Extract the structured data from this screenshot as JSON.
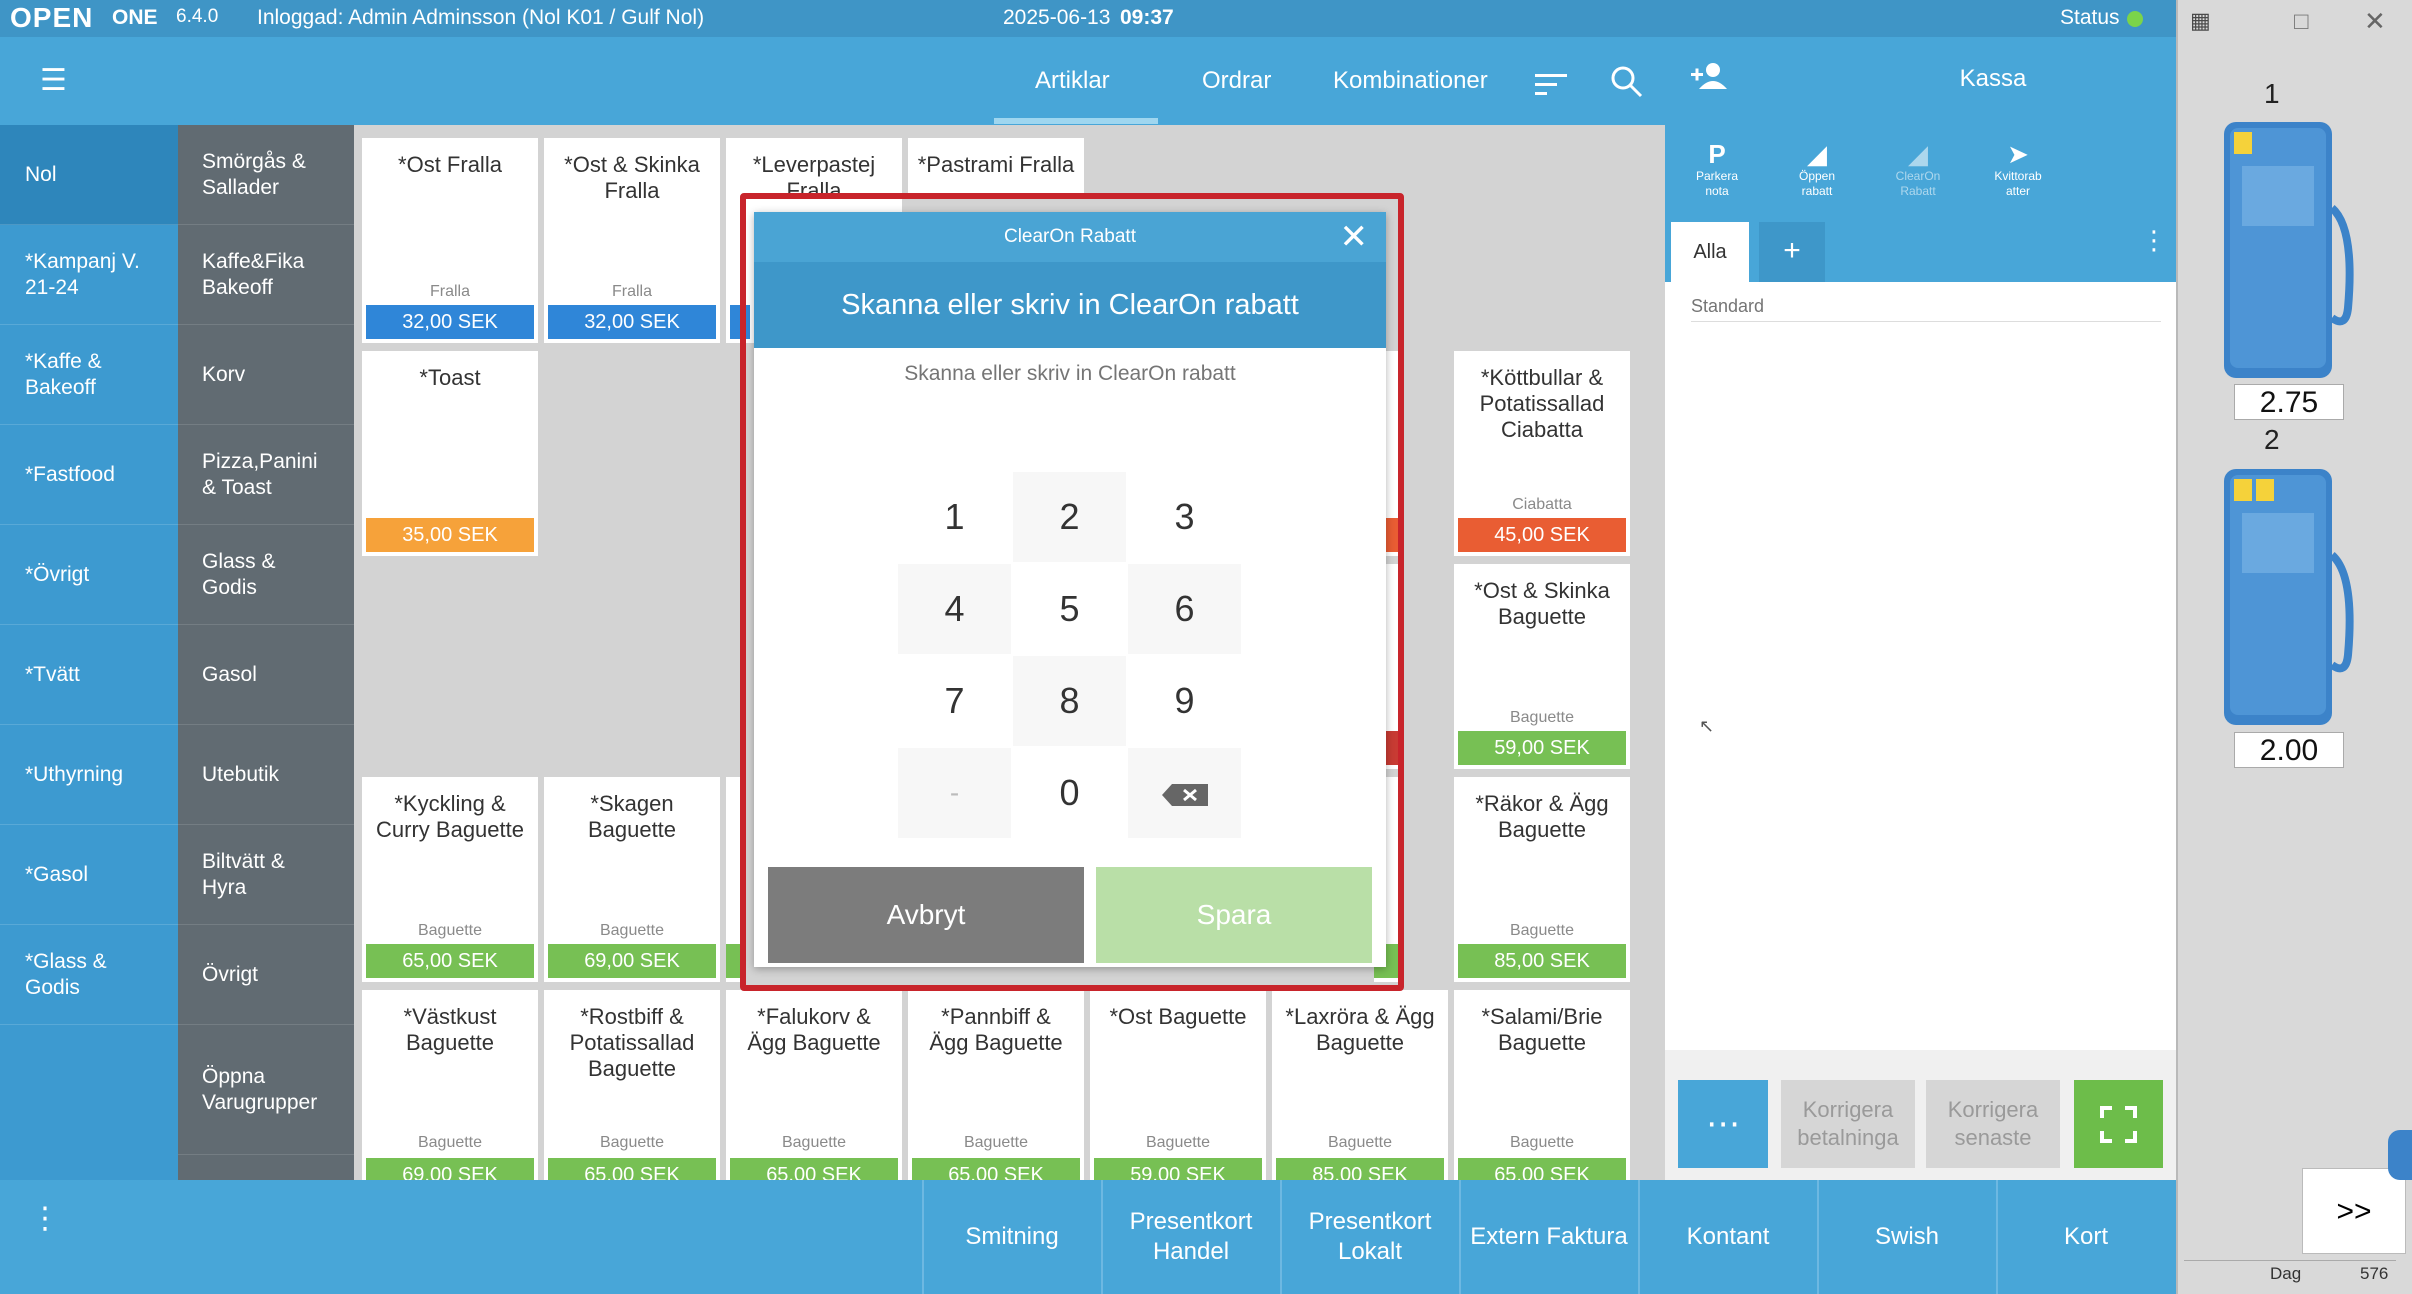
{
  "topbar": {
    "logo": "OPEN",
    "product": "ONE",
    "version": "6.4.0",
    "user": "Inloggad: Admin Adminsson (Nol K01 / Gulf Nol)",
    "date": "2025-06-13",
    "time": "09:37",
    "status": "Status"
  },
  "nav": {
    "tabs": [
      "Artiklar",
      "Ordrar",
      "Kombinationer"
    ],
    "active_tab": "Artiklar"
  },
  "categories_main": [
    "Nol",
    "*Kampanj V.\n21-24",
    "*Kaffe &\nBakeoff",
    "*Fastfood",
    "*Övrigt",
    "*Tvätt",
    "*Uthyrning",
    "*Gasol",
    "*Glass &\nGodis"
  ],
  "categories_sub": [
    "Smörgås &\nSallader",
    "Kaffe&Fika\nBakeoff",
    "Korv",
    "Pizza,Panini\n& Toast",
    "Glass &\nGodis",
    "Gasol",
    "Utebutik",
    "Biltvätt &\nHyra",
    "Övrigt",
    "Öppna\nVarugrupper"
  ],
  "products": [
    {
      "name": "*Ost Fralla",
      "cat": "Fralla",
      "price": "32,00 SEK"
    },
    {
      "name": "*Ost & Skinka\nFralla",
      "cat": "Fralla",
      "price": "32,00 SEK"
    },
    {
      "name": "*Leverpastej\nFralla",
      "cat": "",
      "price": ""
    },
    {
      "name": "*Pastrami Fralla",
      "cat": "",
      "price": ""
    },
    {
      "name": "*Toast",
      "cat": "",
      "price": "35,00 SEK"
    },
    {
      "name": "*Köttbullar &\nPotatissallad\nCiabatta",
      "cat": "Ciabatta",
      "price": "45,00 SEK"
    },
    {
      "name": "*Ost & Skinka\nBaguette",
      "cat": "Baguette",
      "price": "59,00 SEK"
    },
    {
      "name": "*Kyckling &\nCurry Baguette",
      "cat": "Baguette",
      "price": "65,00 SEK"
    },
    {
      "name": "*Skagen\nBaguette",
      "cat": "Baguette",
      "price": "69,00 SEK"
    },
    {
      "name": "*Räkor & Ägg\nBaguette",
      "cat": "Baguette",
      "price": "85,00 SEK"
    },
    {
      "name": "*Västkust\nBaguette",
      "cat": "Baguette",
      "price": "69,00 SEK"
    },
    {
      "name": "*Rostbiff &\nPotatissallad\nBaguette",
      "cat": "Baguette",
      "price": "65,00 SEK"
    },
    {
      "name": "*Falukorv &\nÄgg Baguette",
      "cat": "Baguette",
      "price": "65,00 SEK"
    },
    {
      "name": "*Pannbiff &\nÄgg Baguette",
      "cat": "Baguette",
      "price": "65,00 SEK"
    },
    {
      "name": "*Ost Baguette",
      "cat": "Baguette",
      "price": "59,00 SEK"
    },
    {
      "name": "*Laxröra & Ägg\nBaguette",
      "cat": "Baguette",
      "price": "85,00 SEK"
    },
    {
      "name": "*Salami/Brie\nBaguette",
      "cat": "Baguette",
      "price": "65,00 SEK"
    }
  ],
  "right_panel": {
    "title": "Kassa",
    "actions": [
      "Parkera\nnota",
      "Öppen\nrabatt",
      "ClearOn\nRabatt",
      "Kvittorab\natter"
    ],
    "tab_all": "Alla",
    "pricelist_placeholder": "Standard",
    "btn_correct_payments": "Korrigera\nbetalninga",
    "btn_correct_latest": "Korrigera\nsenaste"
  },
  "bottom_buttons": [
    "Smitning",
    "Presentkort\nHandel",
    "Presentkort\nLokalt",
    "Extern Faktura",
    "Kontant",
    "Swish",
    "Kort"
  ],
  "side_panel": {
    "pumps": [
      {
        "number": "1",
        "value": "2.75"
      },
      {
        "number": "2",
        "value": "2.00"
      }
    ],
    "next_label": ">>",
    "footer_label": "Dag",
    "footer_value": "576"
  },
  "modal": {
    "title": "ClearOn Rabatt",
    "header": "Skanna eller skriv in ClearOn rabatt",
    "input_placeholder": "Skanna eller skriv in ClearOn rabatt",
    "keys": [
      "1",
      "2",
      "3",
      "4",
      "5",
      "6",
      "7",
      "8",
      "9",
      "-",
      "0"
    ],
    "cancel": "Avbryt",
    "save": "Spara"
  },
  "colors": {
    "primary": "#48a6d8",
    "highlight_border": "#c8242b",
    "price_blue": "#2f86d8",
    "price_green": "#77c054",
    "price_orange": "#f6a23a",
    "price_red": "#e95d33"
  }
}
